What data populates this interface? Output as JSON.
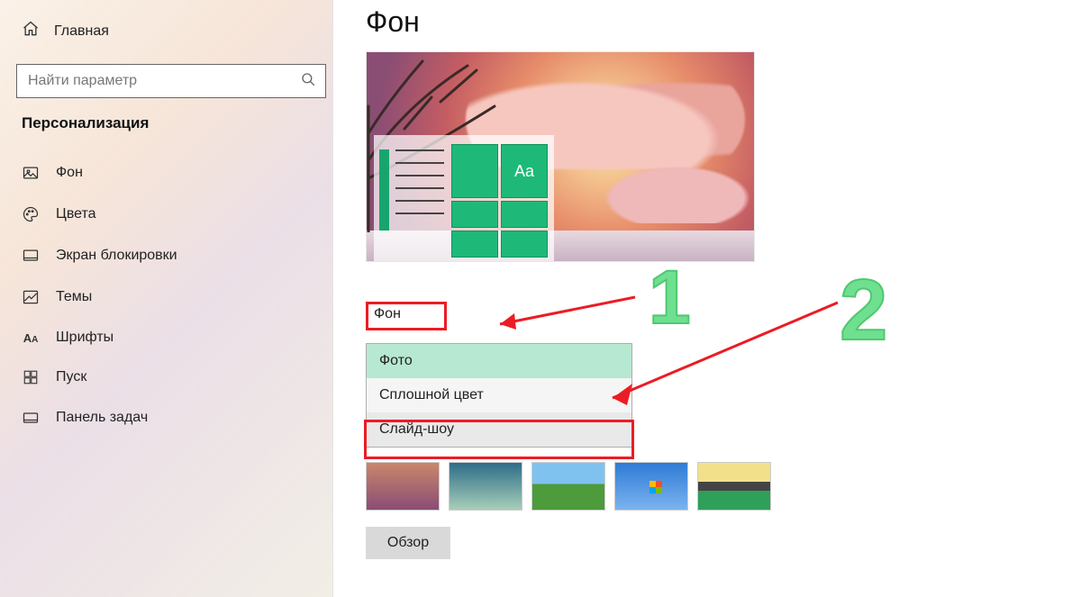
{
  "sidebar": {
    "home_label": "Главная",
    "search_placeholder": "Найти параметр",
    "section_title": "Персонализация",
    "items": [
      {
        "icon": "picture-icon",
        "label": "Фон"
      },
      {
        "icon": "palette-icon",
        "label": "Цвета"
      },
      {
        "icon": "lockscreen-icon",
        "label": "Экран блокировки"
      },
      {
        "icon": "themes-icon",
        "label": "Темы"
      },
      {
        "icon": "fonts-icon",
        "label": "Шрифты"
      },
      {
        "icon": "start-icon",
        "label": "Пуск"
      },
      {
        "icon": "taskbar-icon",
        "label": "Панель задач"
      }
    ]
  },
  "main": {
    "page_title": "Фон",
    "preview_sample_text": "Aa",
    "dropdown_label": "Фон",
    "dropdown_options": [
      {
        "label": "Фото",
        "state": "selected"
      },
      {
        "label": "Сплошной цвет",
        "state": "normal"
      },
      {
        "label": "Слайд-шоу",
        "state": "hover"
      }
    ],
    "browse_label": "Обзор"
  },
  "annotations": {
    "number_1": "1",
    "number_2": "2"
  },
  "colors": {
    "accent_green": "#1eb978",
    "annotation_red": "#ec1c24",
    "annotation_green": "#6fe08f"
  }
}
